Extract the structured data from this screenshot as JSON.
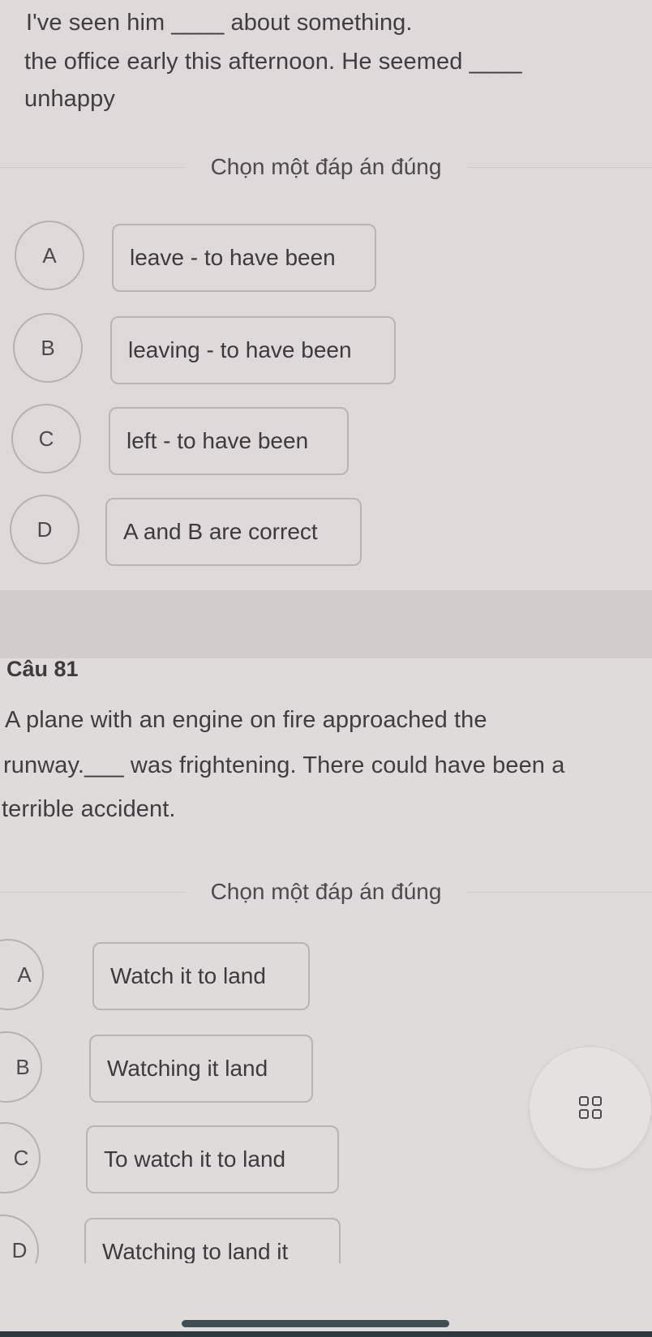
{
  "question_80": {
    "text_lines": [
      "I've seen him ____   about something.",
      "the office early this afternoon. He seemed ____",
      "unhappy"
    ],
    "prompt": "Chọn một đáp án đúng",
    "options": [
      {
        "letter": "A",
        "text": "leave - to have been"
      },
      {
        "letter": "B",
        "text": "leaving - to have been"
      },
      {
        "letter": "C",
        "text": "left - to have been"
      },
      {
        "letter": "D",
        "text": "A and B are correct"
      }
    ]
  },
  "question_81": {
    "title": "Câu 81",
    "text_lines": [
      "A plane with an engine on fire approached the",
      "runway.___ was frightening. There could have been a",
      "terrible accident."
    ],
    "prompt": "Chọn một đáp án đúng",
    "options": [
      {
        "letter": "A",
        "text": "Watch it to land"
      },
      {
        "letter": "B",
        "text": "Watching it land"
      },
      {
        "letter": "C",
        "text": "To watch it to land"
      },
      {
        "letter": "D",
        "text": "Watching to land it"
      }
    ]
  },
  "fab": {
    "icon": "grid-menu-icon"
  }
}
